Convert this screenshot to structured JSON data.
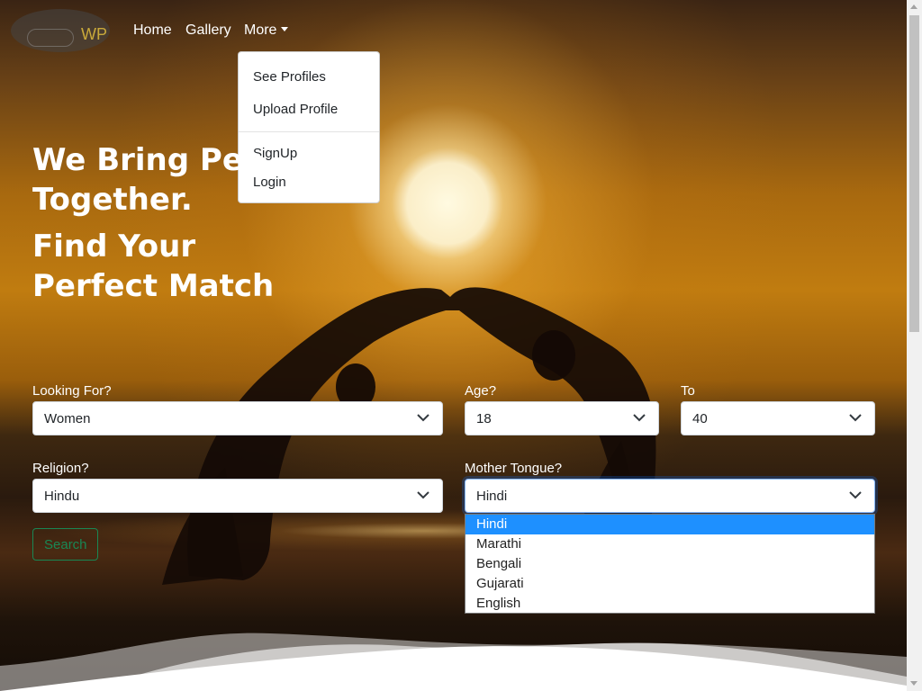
{
  "brand": {
    "logo_text": "WP"
  },
  "nav": {
    "home": "Home",
    "gallery": "Gallery",
    "more": "More"
  },
  "dropdown": {
    "items": [
      "See Profiles",
      "Upload Profile",
      "SignUp",
      "Login"
    ]
  },
  "hero": {
    "line1": "We Bring Peo",
    "line2": "Together.",
    "line3": "Find Your",
    "line4": "Perfect Match"
  },
  "form": {
    "looking_for": {
      "label": "Looking For?",
      "value": "Women"
    },
    "age": {
      "label": "Age?",
      "value": "18"
    },
    "to": {
      "label": "To",
      "value": "40"
    },
    "religion": {
      "label": "Religion?",
      "value": "Hindu"
    },
    "mother_tongue": {
      "label": "Mother Tongue?",
      "value": "Hindi",
      "options": [
        "Hindi",
        "Marathi",
        "Bengali",
        "Gujarati",
        "English"
      ],
      "selected_index": 0
    },
    "search_label": "Search"
  },
  "colors": {
    "accent_green": "#198754",
    "selected_option": "#1e90ff",
    "logo_gold": "#c9a93a"
  }
}
